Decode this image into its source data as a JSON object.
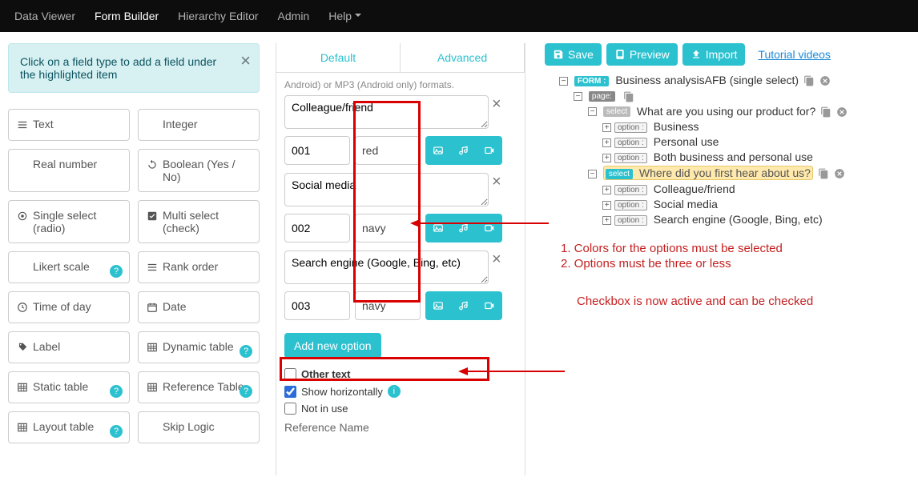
{
  "nav": {
    "items": [
      "Data Viewer",
      "Form Builder",
      "Hierarchy Editor",
      "Admin",
      "Help"
    ],
    "active": 1
  },
  "hint": "Click on a field type to add a field under the highlighted item",
  "fieldTypes": [
    {
      "label": "Text",
      "icon": "list"
    },
    {
      "label": "Integer",
      "icon": ""
    },
    {
      "label": "Real number",
      "icon": ""
    },
    {
      "label": "Boolean (Yes / No)",
      "icon": "refresh"
    },
    {
      "label": "Single select (radio)",
      "icon": "dot"
    },
    {
      "label": "Multi select (check)",
      "icon": "check"
    },
    {
      "label": "Likert scale",
      "icon": "",
      "help": true
    },
    {
      "label": "Rank order",
      "icon": "list"
    },
    {
      "label": "Time of day",
      "icon": "clock"
    },
    {
      "label": "Date",
      "icon": "cal"
    },
    {
      "label": "Label",
      "icon": "tag"
    },
    {
      "label": "Dynamic table",
      "icon": "table",
      "help": true
    },
    {
      "label": "Static table",
      "icon": "table",
      "help": true
    },
    {
      "label": "Reference Table",
      "icon": "table",
      "help": true
    },
    {
      "label": "Layout table",
      "icon": "table",
      "help": true
    },
    {
      "label": "Skip Logic",
      "icon": ""
    }
  ],
  "editor": {
    "tabs": [
      "Default",
      "Advanced"
    ],
    "cutline": "Android) or MP3 (Android only) formats.",
    "options": [
      {
        "text": "Colleague/friend",
        "code": "001",
        "color": "red"
      },
      {
        "text": "Social media",
        "code": "002",
        "color": "navy"
      },
      {
        "text": "Search engine (Google, Bing, etc)",
        "code": "003",
        "color": "navy"
      }
    ],
    "addNew": "Add new option",
    "otherText": {
      "label": "Other text",
      "checked": false
    },
    "showH": {
      "label": "Show horizontally",
      "checked": true
    },
    "notInUse": {
      "label": "Not in use",
      "checked": false
    },
    "refName": "Reference Name"
  },
  "actions": {
    "save": "Save",
    "preview": "Preview",
    "import": "Import",
    "tutorial": "Tutorial videos"
  },
  "tree": {
    "form": "Business analysisAFB (single select)",
    "page": "",
    "q1": {
      "label": "What are you using our product for?",
      "opts": [
        "Business",
        "Personal use",
        "Both business and personal use"
      ]
    },
    "q2": {
      "label": "Where did you first hear about us?",
      "opts": [
        "Colleague/friend",
        "Social media",
        "Search engine (Google, Bing, etc)"
      ]
    }
  },
  "ann": {
    "r1": "1. Colors for the options must be selected",
    "r2": "2. Options must be three or less",
    "c2": "Checkbox is now active and can be checked"
  }
}
